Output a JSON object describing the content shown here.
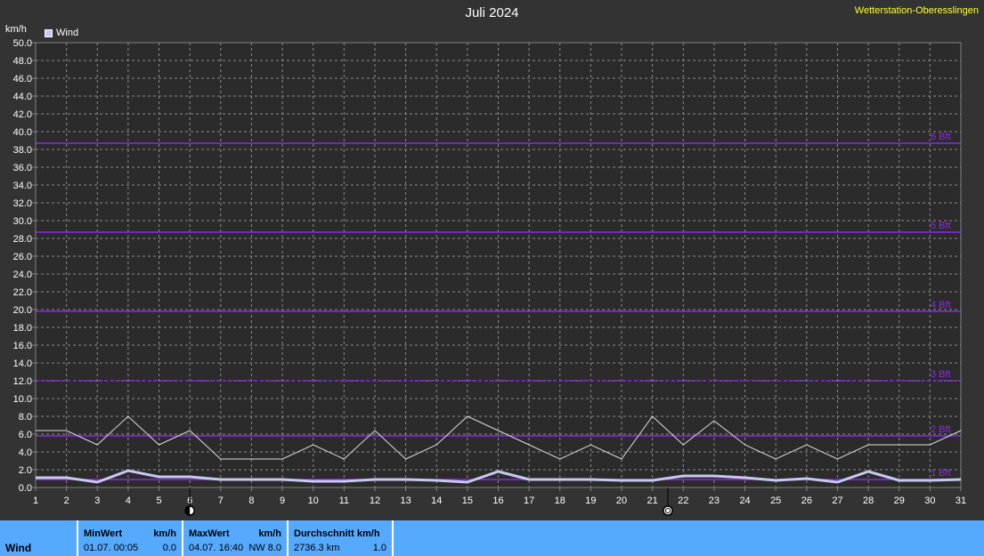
{
  "header": {
    "title": "Juli 2024",
    "station": "Wetterstation-Oberesslingen",
    "unit": "km/h",
    "legend": "Wind"
  },
  "chart_data": {
    "type": "line",
    "title": "Juli 2024",
    "ylabel": "km/h",
    "xlabel": "",
    "xlim": [
      1,
      31
    ],
    "ylim": [
      0,
      50
    ],
    "grid": true,
    "x": [
      1,
      2,
      3,
      4,
      5,
      6,
      7,
      8,
      9,
      10,
      11,
      12,
      13,
      14,
      15,
      16,
      17,
      18,
      19,
      20,
      21,
      22,
      23,
      24,
      25,
      26,
      27,
      28,
      29,
      30,
      31
    ],
    "series": [
      {
        "name": "Wind",
        "values": [
          1.1,
          1.1,
          0.6,
          1.9,
          1.2,
          1.2,
          0.9,
          0.9,
          0.9,
          0.7,
          0.7,
          0.9,
          0.9,
          0.8,
          0.6,
          1.8,
          0.9,
          0.9,
          0.9,
          0.8,
          0.8,
          1.3,
          1.3,
          1.1,
          0.8,
          1.0,
          0.6,
          1.8,
          0.8,
          0.8,
          0.9
        ],
        "color": "#c8c8f0"
      },
      {
        "values": [
          6.4,
          6.4,
          4.8,
          8.0,
          4.8,
          6.4,
          3.2,
          3.2,
          3.2,
          4.8,
          3.2,
          6.4,
          3.2,
          4.8,
          8.0,
          6.4,
          4.8,
          3.2,
          4.8,
          3.2,
          8.0,
          4.8,
          7.5,
          4.8,
          3.2,
          4.8,
          3.2,
          4.8,
          4.8,
          4.8,
          6.4
        ],
        "color": "#dcdcdc"
      }
    ],
    "beaufort_lines": [
      {
        "label": "1 Bft",
        "value": 0.9,
        "style": "solid"
      },
      {
        "label": "2 Bft",
        "value": 5.8,
        "style": "solid"
      },
      {
        "label": "3 Bft",
        "value": 12.0,
        "style": "dashed"
      },
      {
        "label": "4 Bft",
        "value": 19.8,
        "style": "solid"
      },
      {
        "label": "5 Bft",
        "value": 28.7,
        "style": "solid"
      },
      {
        "label": "6 Bft",
        "value": 38.7,
        "style": "solid"
      }
    ],
    "moon_markers": [
      {
        "day": 6,
        "icon": "full-moon-icon"
      },
      {
        "day": 21.5,
        "icon": "new-moon-icon"
      }
    ],
    "colors": {
      "background": "#333333",
      "plot_background": "#2b2b2b",
      "axis": "#808080",
      "grid": "#8a8a8a",
      "beaufort": "#8a2be2"
    }
  },
  "footer": {
    "series": "Wind",
    "min": {
      "label": "MinWert",
      "unit": "km/h",
      "date": "01.07.  00:05",
      "value": "0.0"
    },
    "max": {
      "label": "MaxWert",
      "unit": "km/h",
      "date": "04.07.  16:40",
      "value": "NW 8.0"
    },
    "avg": {
      "label": "Durchschnitt km/h",
      "distance": "2736.3 km",
      "value": "1.0"
    }
  }
}
